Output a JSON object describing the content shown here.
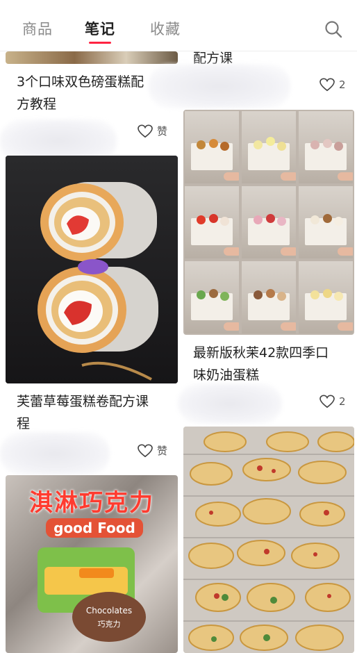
{
  "tabs": [
    {
      "label": "商品",
      "active": false
    },
    {
      "label": "笔记",
      "active": true
    },
    {
      "label": "收藏",
      "active": false
    }
  ],
  "accent_color": "#ff2442",
  "search_icon": "search-icon",
  "left_column": [
    {
      "title_line1": "3个口味双色磅蛋糕配",
      "title_line2": "方教程",
      "like_label": "赞"
    },
    {
      "title_line1": "芙蕾草莓蛋糕卷配方课",
      "title_line2": "程",
      "like_label": "赞"
    },
    {
      "overlay_text": "淇淋巧克力",
      "overlay_sub": "good Food",
      "package_text": "Chocolates",
      "package_sub": "巧克力"
    }
  ],
  "right_column": [
    {
      "title_line1": "配方课",
      "like_count": "2"
    },
    {
      "title_line1": "最新版秋茉42款四季口",
      "title_line2": "味奶油蛋糕",
      "like_count": "2"
    }
  ]
}
